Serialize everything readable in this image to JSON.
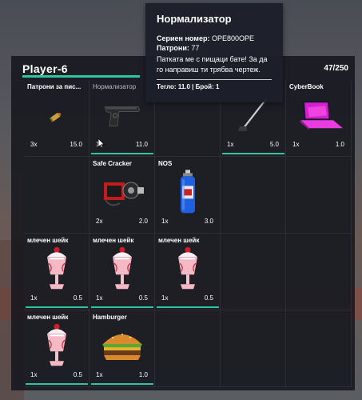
{
  "player": {
    "name": "Player-6",
    "weight": "47/250",
    "weight_fraction": 0.188
  },
  "tooltip": {
    "title": "Нормализатор",
    "serial_label": "Сериен номер:",
    "serial_value": "OPE800OPE",
    "ammo_label": "Патрони:",
    "ammo_value": "77",
    "description": "Патката ме с пищаци бате! За да го направиш ти трябва чертеж.",
    "footer": "Тегло: 11.0 | Брой: 1"
  },
  "colors": {
    "accent": "#2ec6a0",
    "panel": "#16171e",
    "tooltip": "#1c1e2a"
  },
  "slots": [
    {
      "label": "Патрони за пис...",
      "count": "3x",
      "weight": "15.0",
      "icon": "ammo-icon",
      "durability": null
    },
    {
      "label": "Нормализатор",
      "count": "1x",
      "weight": "11.0",
      "icon": "pistol-icon",
      "durability": 1.0
    },
    {
      "label": "",
      "count": "",
      "weight": "",
      "icon": "",
      "durability": null
    },
    {
      "label": "",
      "count": "1x",
      "weight": "5.0",
      "icon": "golf-club-icon",
      "durability": 1.0
    },
    {
      "label": "CyberBook",
      "count": "1x",
      "weight": "1.0",
      "icon": "laptop-icon",
      "durability": null
    },
    {
      "label": "",
      "count": "",
      "weight": "",
      "icon": "",
      "durability": null
    },
    {
      "label": "Safe Cracker",
      "count": "2x",
      "weight": "2.0",
      "icon": "safe-cracker-icon",
      "durability": null
    },
    {
      "label": "NOS",
      "count": "1x",
      "weight": "3.0",
      "icon": "nos-icon",
      "durability": null
    },
    {
      "label": "",
      "count": "",
      "weight": "",
      "icon": "",
      "durability": null
    },
    {
      "label": "",
      "count": "",
      "weight": "",
      "icon": "",
      "durability": null
    },
    {
      "label": "млечен шейк",
      "count": "1x",
      "weight": "0.5",
      "icon": "milkshake-icon",
      "durability": 1.0
    },
    {
      "label": "млечен шейк",
      "count": "1x",
      "weight": "0.5",
      "icon": "milkshake-icon",
      "durability": 1.0
    },
    {
      "label": "млечен шейк",
      "count": "1x",
      "weight": "0.5",
      "icon": "milkshake-icon",
      "durability": 1.0
    },
    {
      "label": "",
      "count": "",
      "weight": "",
      "icon": "",
      "durability": null
    },
    {
      "label": "",
      "count": "",
      "weight": "",
      "icon": "",
      "durability": null
    },
    {
      "label": "млечен шейк",
      "count": "1x",
      "weight": "0.5",
      "icon": "milkshake-icon",
      "durability": 1.0
    },
    {
      "label": "Hamburger",
      "count": "1x",
      "weight": "1.0",
      "icon": "hamburger-icon",
      "durability": 1.0
    },
    {
      "label": "",
      "count": "",
      "weight": "",
      "icon": "",
      "durability": null
    },
    {
      "label": "",
      "count": "",
      "weight": "",
      "icon": "",
      "durability": null
    },
    {
      "label": "",
      "count": "",
      "weight": "",
      "icon": "",
      "durability": null
    }
  ]
}
